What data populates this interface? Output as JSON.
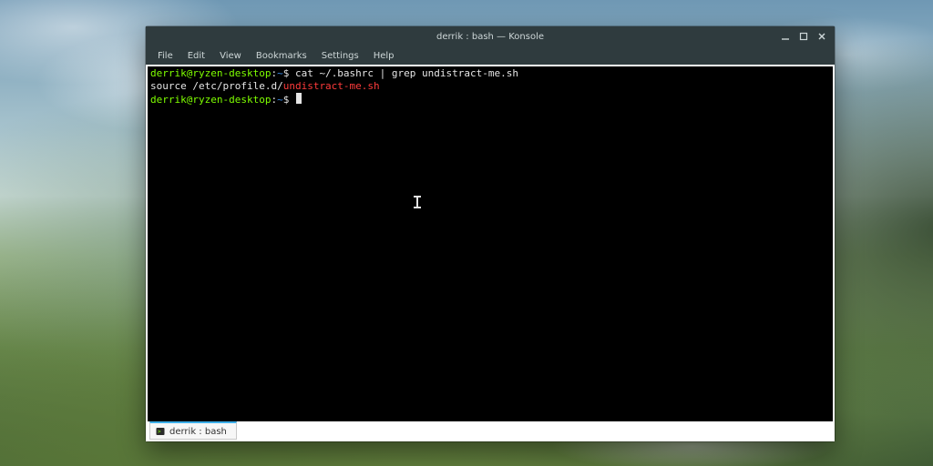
{
  "window": {
    "title": "derrik : bash — Konsole"
  },
  "menubar": {
    "items": [
      "File",
      "Edit",
      "View",
      "Bookmarks",
      "Settings",
      "Help"
    ]
  },
  "terminal": {
    "prompt1": {
      "user_host": "derrik@ryzen-desktop",
      "colon": ":",
      "path": "~",
      "sigil": "$",
      "command": "cat ~/.bashrc | grep undistract-me.sh"
    },
    "output1": {
      "prefix": "source /etc/profile.d/",
      "match": "undistract-me.sh"
    },
    "prompt2": {
      "user_host": "derrik@ryzen-desktop",
      "colon": ":",
      "path": "~",
      "sigil": "$"
    }
  },
  "tab": {
    "label": "derrik : bash"
  }
}
